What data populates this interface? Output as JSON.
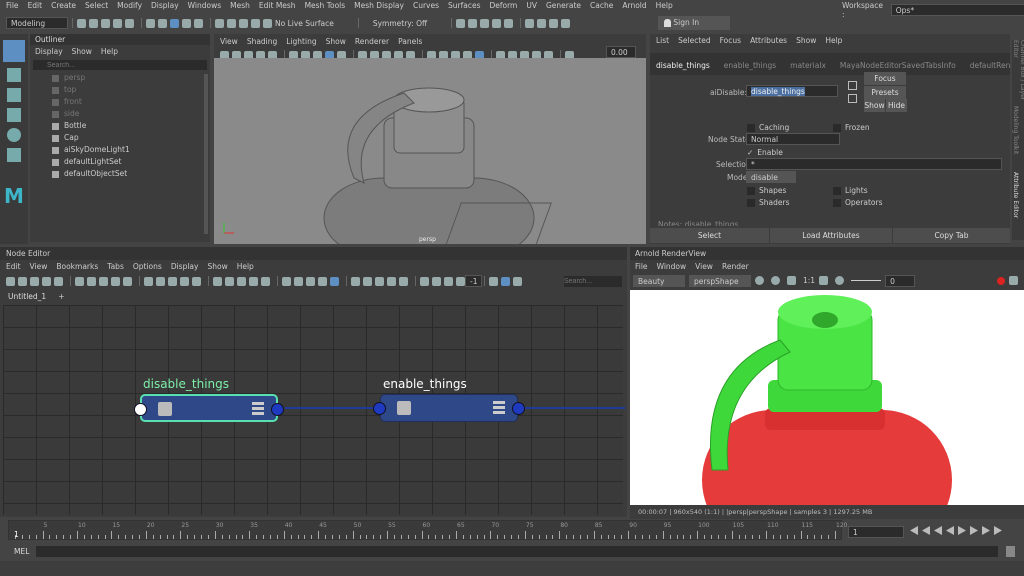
{
  "menubar": [
    "File",
    "Edit",
    "Create",
    "Select",
    "Modify",
    "Display",
    "Windows",
    "Mesh",
    "Edit Mesh",
    "Mesh Tools",
    "Mesh Display",
    "Curves",
    "Surfaces",
    "Deform",
    "UV",
    "Generate",
    "Cache",
    "Arnold",
    "Help"
  ],
  "workspace": {
    "label": "Workspace :",
    "value": "Ops*"
  },
  "status_line": {
    "mode": "Modeling",
    "live_surface": "No Live Surface",
    "symmetry": "Symmetry: Off",
    "sign_in": "Sign In"
  },
  "outliner": {
    "title": "Outliner",
    "menu": [
      "Display",
      "Show",
      "Help"
    ],
    "search_placeholder": "Search...",
    "items": [
      {
        "label": "persp",
        "dim": true
      },
      {
        "label": "top",
        "dim": true
      },
      {
        "label": "front",
        "dim": true
      },
      {
        "label": "side",
        "dim": true
      },
      {
        "label": "Bottle",
        "dim": false
      },
      {
        "label": "Cap",
        "dim": false
      },
      {
        "label": "aiSkyDomeLight1",
        "dim": false
      },
      {
        "label": "defaultLightSet",
        "dim": false
      },
      {
        "label": "defaultObjectSet",
        "dim": false
      }
    ]
  },
  "viewport": {
    "menu": [
      "View",
      "Shading",
      "Lighting",
      "Show",
      "Renderer",
      "Panels"
    ],
    "value": "0.00",
    "camera": "persp"
  },
  "attr_editor": {
    "menu": [
      "List",
      "Selected",
      "Focus",
      "Attributes",
      "Show",
      "Help"
    ],
    "tabs": [
      "disable_things",
      "enable_things",
      "materialx",
      "MayaNodeEditorSavedTabsInfo",
      "defaultRenderI"
    ],
    "node_label": "aiDisable:",
    "node_name": "disable_things",
    "focus": "Focus",
    "presets": "Presets",
    "show": "Show",
    "hide": "Hide",
    "caching": "Caching",
    "frozen": "Frozen",
    "node_state_label": "Node State",
    "node_state": "Normal",
    "enable": "Enable",
    "selection_label": "Selection",
    "selection_value": "*",
    "mode_label": "Mode",
    "mode": "disable",
    "shapes": "Shapes",
    "lights": "Lights",
    "shaders": "Shaders",
    "operators": "Operators",
    "notes": "Notes: disable_things",
    "select_btn": "Select",
    "load_btn": "Load Attributes",
    "copy_btn": "Copy Tab",
    "side_tabs": [
      "Channel Box / Layer Editor",
      "Modeling Toolkit",
      "Attribute Editor"
    ]
  },
  "node_editor": {
    "title": "Node Editor",
    "menu": [
      "Edit",
      "View",
      "Bookmarks",
      "Tabs",
      "Options",
      "Display",
      "Show",
      "Help"
    ],
    "counter": "-1",
    "search_placeholder": "Search...",
    "tab": "Untitled_1",
    "add_tab": "+",
    "nodes": [
      {
        "name": "disable_things",
        "selected": true
      },
      {
        "name": "enable_things",
        "selected": false
      }
    ]
  },
  "render_view": {
    "title": "Arnold RenderView",
    "menu": [
      "File",
      "Window",
      "View",
      "Render"
    ],
    "aov": "Beauty",
    "camera": "perspShape",
    "ratio": "1:1",
    "exposure": "0",
    "status": "00:00:07 | 960x540 (1:1) | |persp|perspShape  | samples 3 | 1297.25 MB"
  },
  "timeline": {
    "ticks": [
      "5",
      "10",
      "15",
      "20",
      "25",
      "30",
      "35",
      "40",
      "45",
      "50",
      "55",
      "60",
      "65",
      "70",
      "75",
      "80",
      "85",
      "90",
      "95",
      "100",
      "105",
      "110",
      "115",
      "120"
    ],
    "start": "1",
    "current_frame": "1"
  },
  "command_line": {
    "label": "MEL"
  },
  "colors": {
    "accent": "#5d8fc2",
    "node": "#2e4888",
    "selected_node_border": "#5ae0b0",
    "bottle": "#e53935",
    "cap": "#3fd43a"
  }
}
